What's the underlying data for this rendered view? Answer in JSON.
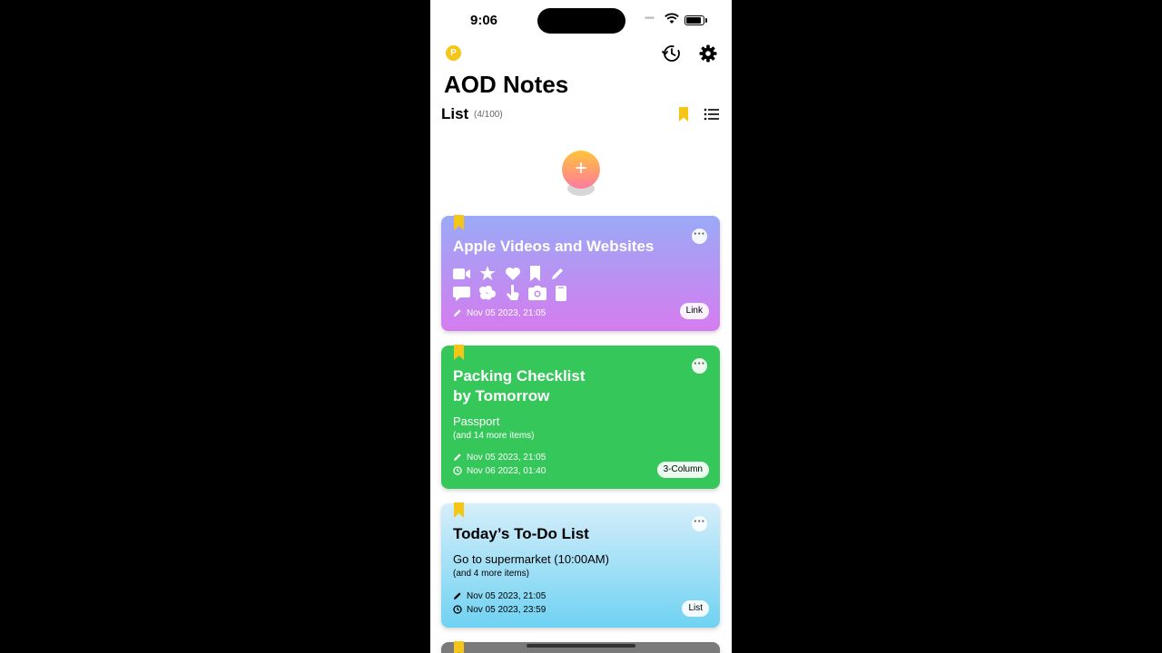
{
  "status_bar": {
    "time": "9:06",
    "signal": "••••"
  },
  "header": {
    "premium_badge": "P",
    "title": "AOD Notes"
  },
  "list_header": {
    "label": "List",
    "count": "(4/100)"
  },
  "notes": [
    {
      "title": "Apple Videos and Websites",
      "icons": [
        "video-icon",
        "star-icon",
        "heart-icon",
        "bookmark-icon",
        "pencil-icon",
        "chat-bubble-icon",
        "brain-icon",
        "hand-pointer-icon",
        "camera-icon",
        "phone-icon"
      ],
      "edited": "Nov 05 2023, 21:05",
      "tag": "Link",
      "bookmarked": true
    },
    {
      "title_line1": "Packing Checklist",
      "title_line2": "by Tomorrow",
      "preview": "Passport",
      "more_items": "(and 14 more items)",
      "edited": "Nov 05 2023, 21:05",
      "due": "Nov 06 2023, 01:40",
      "tag": "3-Column",
      "bookmarked": true
    },
    {
      "title": "Today’s To-Do List",
      "preview": "Go to supermarket (10:00AM)",
      "more_items": "(and 4 more items)",
      "edited": "Nov 05 2023, 21:05",
      "due": "Nov 05 2023, 23:59",
      "tag": "List",
      "bookmarked": true
    },
    {
      "bookmarked": true
    }
  ],
  "colors": {
    "accent_yellow": "#f5c518",
    "card1_top": "#9aaaf6",
    "card1_bottom": "#d57cef",
    "card2": "#35c75a",
    "card3_top": "#d6eefa",
    "card3_bottom": "#6fd2f2"
  }
}
